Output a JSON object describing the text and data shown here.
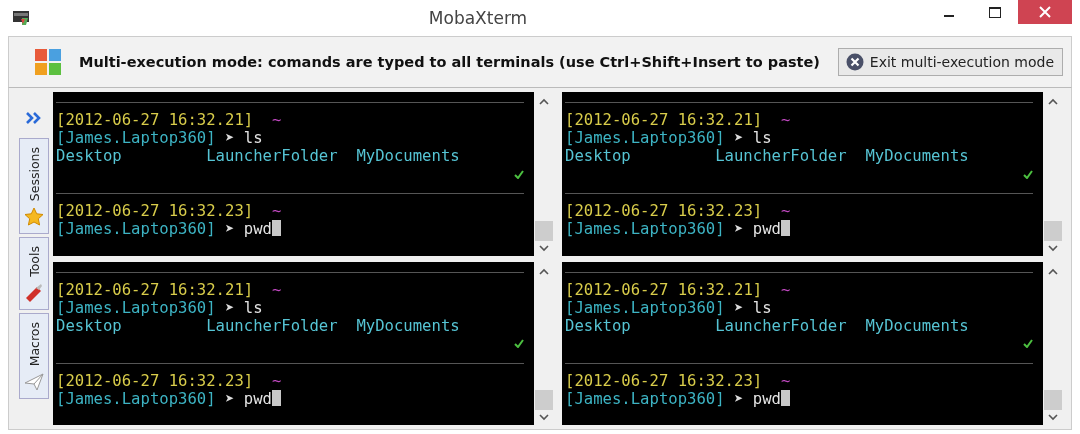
{
  "window": {
    "title": "MobaXterm"
  },
  "banner": {
    "message": "Multi-execution mode: comands are typed to all terminals (use Ctrl+Shift+Insert to paste)",
    "exit_button": "Exit multi-execution mode"
  },
  "sidebar": {
    "tabs": [
      {
        "label": "Sessions"
      },
      {
        "label": "Tools"
      },
      {
        "label": "Macros"
      }
    ]
  },
  "terminals": [
    {
      "entries": [
        {
          "timestamp": "[2012-06-27 16:32.21]",
          "directory": "~",
          "prompt": "[James.Laptop360]",
          "symbol": "➤",
          "command": "ls",
          "output": [
            "Desktop",
            "LauncherFolder",
            "MyDocuments"
          ],
          "success": true
        },
        {
          "timestamp": "[2012-06-27 16:32.23]",
          "directory": "~",
          "prompt": "[James.Laptop360]",
          "symbol": "➤",
          "command": "pwd",
          "cursor": true
        }
      ]
    },
    {
      "entries": [
        {
          "timestamp": "[2012-06-27 16:32.21]",
          "directory": "~",
          "prompt": "[James.Laptop360]",
          "symbol": "➤",
          "command": "ls",
          "output": [
            "Desktop",
            "LauncherFolder",
            "MyDocuments"
          ],
          "success": true
        },
        {
          "timestamp": "[2012-06-27 16:32.23]",
          "directory": "~",
          "prompt": "[James.Laptop360]",
          "symbol": "➤",
          "command": "pwd",
          "cursor": true
        }
      ]
    },
    {
      "entries": [
        {
          "timestamp": "[2012-06-27 16:32.21]",
          "directory": "~",
          "prompt": "[James.Laptop360]",
          "symbol": "➤",
          "command": "ls",
          "output": [
            "Desktop",
            "LauncherFolder",
            "MyDocuments"
          ],
          "success": true
        },
        {
          "timestamp": "[2012-06-27 16:32.23]",
          "directory": "~",
          "prompt": "[James.Laptop360]",
          "symbol": "➤",
          "command": "pwd",
          "cursor": true
        }
      ]
    },
    {
      "entries": [
        {
          "timestamp": "[2012-06-27 16:32.21]",
          "directory": "~",
          "prompt": "[James.Laptop360]",
          "symbol": "➤",
          "command": "ls",
          "output": [
            "Desktop",
            "LauncherFolder",
            "MyDocuments"
          ],
          "success": true
        },
        {
          "timestamp": "[2012-06-27 16:32.23]",
          "directory": "~",
          "prompt": "[James.Laptop360]",
          "symbol": "➤",
          "command": "pwd",
          "cursor": true
        }
      ]
    }
  ]
}
